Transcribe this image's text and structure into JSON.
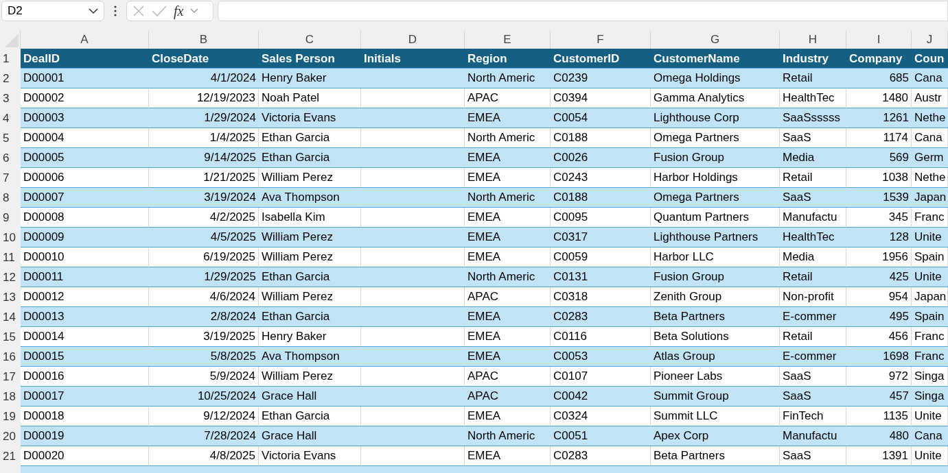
{
  "formula_bar": {
    "name_box": "D2",
    "function_label": "fx"
  },
  "table": {
    "columns": [
      {
        "letter": "A",
        "heading": "DealID"
      },
      {
        "letter": "B",
        "heading": "CloseDate"
      },
      {
        "letter": "C",
        "heading": "Sales Person"
      },
      {
        "letter": "D",
        "heading": "Initials"
      },
      {
        "letter": "E",
        "heading": "Region"
      },
      {
        "letter": "F",
        "heading": "CustomerID"
      },
      {
        "letter": "G",
        "heading": "CustomerName"
      },
      {
        "letter": "H",
        "heading": "Industry"
      },
      {
        "letter": "I",
        "heading": "Company"
      },
      {
        "letter": "J",
        "heading": "Coun"
      }
    ],
    "header_row_number": "1",
    "rows": [
      {
        "number": "2",
        "cells": [
          "D00001",
          "4/1/2024",
          "Henry Baker",
          null,
          "North Americ",
          "C0239",
          "Omega Holdings",
          "Retail",
          "685",
          "Cana"
        ]
      },
      {
        "number": "3",
        "cells": [
          "D00002",
          "12/19/2023",
          "Noah Patel",
          null,
          "APAC",
          "C0394",
          "Gamma Analytics",
          "HealthTec",
          "1480",
          "Austr"
        ]
      },
      {
        "number": "4",
        "cells": [
          "D00003",
          "1/29/2024",
          "Victoria Evans",
          null,
          "EMEA",
          "C0054",
          "Lighthouse Corp",
          "SaaSsssss",
          "1261",
          "Nethe"
        ]
      },
      {
        "number": "5",
        "cells": [
          "D00004",
          "1/4/2025",
          "Ethan Garcia",
          null,
          "North Americ",
          "C0188",
          "Omega Partners",
          "SaaS",
          "1174",
          "Cana"
        ]
      },
      {
        "number": "6",
        "cells": [
          "D00005",
          "9/14/2025",
          "Ethan Garcia",
          null,
          "EMEA",
          "C0026",
          "Fusion Group",
          "Media",
          "569",
          "Germ"
        ]
      },
      {
        "number": "7",
        "cells": [
          "D00006",
          "1/21/2025",
          "William Perez",
          null,
          "EMEA",
          "C0243",
          "Harbor Holdings",
          "Retail",
          "1038",
          "Nethe"
        ]
      },
      {
        "number": "8",
        "cells": [
          "D00007",
          "3/19/2024",
          "Ava Thompson",
          null,
          "North Americ",
          "C0188",
          "Omega Partners",
          "SaaS",
          "1539",
          "Japan"
        ]
      },
      {
        "number": "9",
        "cells": [
          "D00008",
          "4/2/2025",
          "Isabella Kim",
          null,
          "EMEA",
          "C0095",
          "Quantum Partners",
          "Manufactu",
          "345",
          "Franc"
        ]
      },
      {
        "number": "10",
        "cells": [
          "D00009",
          "4/5/2025",
          "William Perez",
          null,
          "EMEA",
          "C0317",
          "Lighthouse Partners",
          "HealthTec",
          "128",
          "Unite"
        ]
      },
      {
        "number": "11",
        "cells": [
          "D00010",
          "6/19/2025",
          "William Perez",
          null,
          "EMEA",
          "C0059",
          "Harbor LLC",
          "Media",
          "1956",
          "Spain"
        ]
      },
      {
        "number": "12",
        "cells": [
          "D00011",
          "1/29/2025",
          "Ethan Garcia",
          null,
          "North Americ",
          "C0131",
          "Fusion Group",
          "Retail",
          "425",
          "Unite"
        ]
      },
      {
        "number": "13",
        "cells": [
          "D00012",
          "4/6/2024",
          "William Perez",
          null,
          "APAC",
          "C0318",
          "Zenith Group",
          "Non-profit",
          "954",
          "Japan"
        ]
      },
      {
        "number": "14",
        "cells": [
          "D00013",
          "2/8/2024",
          "Ethan Garcia",
          null,
          "EMEA",
          "C0283",
          "Beta Partners",
          "E-commer",
          "495",
          "Spain"
        ]
      },
      {
        "number": "15",
        "cells": [
          "D00014",
          "3/19/2025",
          "Henry Baker",
          null,
          "EMEA",
          "C0116",
          "Beta Solutions",
          "Retail",
          "456",
          "Franc"
        ]
      },
      {
        "number": "16",
        "cells": [
          "D00015",
          "5/8/2025",
          "Ava Thompson",
          null,
          "EMEA",
          "C0053",
          "Atlas Group",
          "E-commer",
          "1698",
          "Franc"
        ]
      },
      {
        "number": "17",
        "cells": [
          "D00016",
          "5/9/2024",
          "William Perez",
          null,
          "APAC",
          "C0107",
          "Pioneer Labs",
          "SaaS",
          "972",
          "Singa"
        ]
      },
      {
        "number": "18",
        "cells": [
          "D00017",
          "10/25/2024",
          "Grace Hall",
          null,
          "APAC",
          "C0042",
          "Summit Group",
          "SaaS",
          "457",
          "Singa"
        ]
      },
      {
        "number": "19",
        "cells": [
          "D00018",
          "9/12/2024",
          "Ethan Garcia",
          null,
          "EMEA",
          "C0324",
          "Summit LLC",
          "FinTech",
          "1135",
          "Unite"
        ]
      },
      {
        "number": "20",
        "cells": [
          "D00019",
          "7/28/2024",
          "Grace Hall",
          null,
          "North Americ",
          "C0051",
          "Apex Corp",
          "Manufactu",
          "480",
          "Cana"
        ]
      },
      {
        "number": "21",
        "cells": [
          "D00020",
          "4/8/2025",
          "Victoria Evans",
          null,
          "EMEA",
          "C0283",
          "Beta Partners",
          "SaaS",
          "1391",
          "Unite"
        ]
      }
    ]
  }
}
